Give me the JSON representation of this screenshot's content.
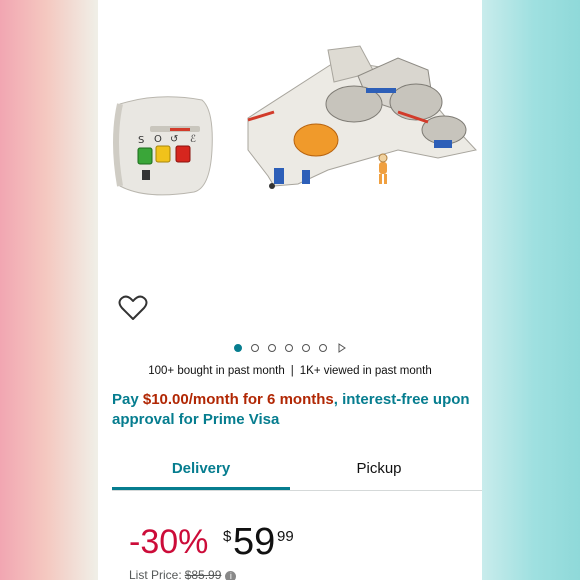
{
  "colors": {
    "accent": "#067d8f",
    "discount": "#cc0c39",
    "promo_amount": "#b12704",
    "text": "#111111",
    "muted": "#565959"
  },
  "carousel": {
    "total_images": 6,
    "active_index": 0
  },
  "icons": {
    "wishlist": "heart-outline-icon",
    "video": "play-triangle-icon",
    "info": "info-circle-icon"
  },
  "social_proof": {
    "bought": "100+ bought in past month",
    "separator": "|",
    "viewed": "1K+ viewed in past month"
  },
  "promo": {
    "prefix": "Pay ",
    "amount": "$10.00/month for 6 months",
    "suffix": ", interest-free upon approval for Prime Visa"
  },
  "tabs": {
    "delivery": "Delivery",
    "pickup": "Pickup",
    "active": "delivery"
  },
  "price": {
    "discount": "-30%",
    "currency": "$",
    "whole": "59",
    "fraction": "99",
    "list_label": "List Price:",
    "list_value": "$85.99"
  }
}
